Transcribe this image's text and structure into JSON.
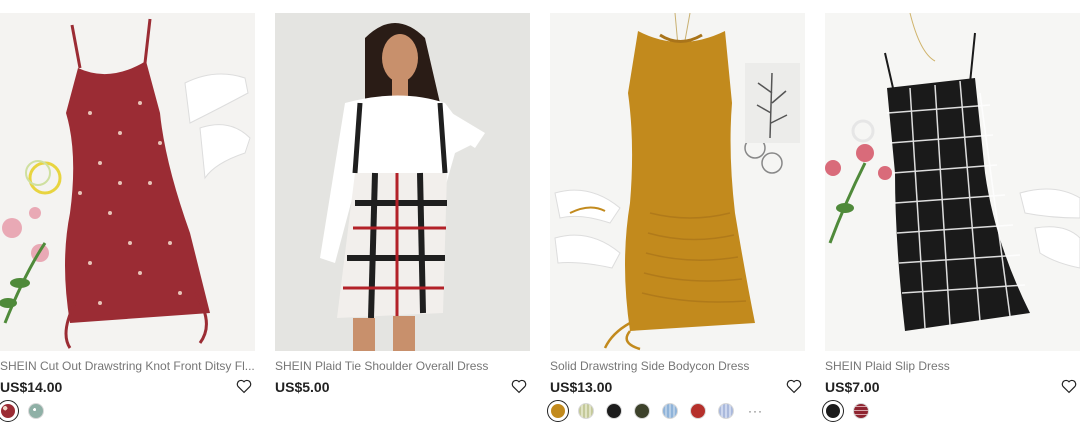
{
  "products": [
    {
      "title": "SHEIN Cut Out Drawstring Knot Front Ditsy Fl...",
      "price": "US$14.00",
      "wishlist_icon": "heart-outline-icon",
      "swatches": [
        {
          "color": "#9b2c34",
          "pattern": "floral",
          "selected": true
        },
        {
          "color": "#8fb0a6",
          "pattern": "floral",
          "selected": false
        }
      ]
    },
    {
      "title": "SHEIN Plaid Tie Shoulder Overall Dress",
      "price": "US$5.00",
      "wishlist_icon": "heart-outline-icon",
      "swatches": []
    },
    {
      "title": "Solid Drawstring Side Bodycon Dress",
      "price": "US$13.00",
      "wishlist_icon": "heart-outline-icon",
      "swatches": [
        {
          "color": "#c28a1d",
          "selected": true
        },
        {
          "color": "#c4c99a",
          "selected": false
        },
        {
          "color": "#1c1c1c",
          "selected": false
        },
        {
          "color": "#3d422b",
          "selected": false
        },
        {
          "color": "#8fb3d9",
          "selected": false
        },
        {
          "color": "#b5302b",
          "selected": false
        },
        {
          "color": "#aab9dc",
          "selected": false
        }
      ],
      "more_label": "···"
    },
    {
      "title": "SHEIN Plaid Slip Dress",
      "price": "US$7.00",
      "wishlist_icon": "heart-outline-icon",
      "swatches": [
        {
          "color": "#1a1a1a",
          "selected": true
        },
        {
          "color": "#8e2430",
          "pattern": "plaid",
          "selected": false
        }
      ]
    }
  ]
}
